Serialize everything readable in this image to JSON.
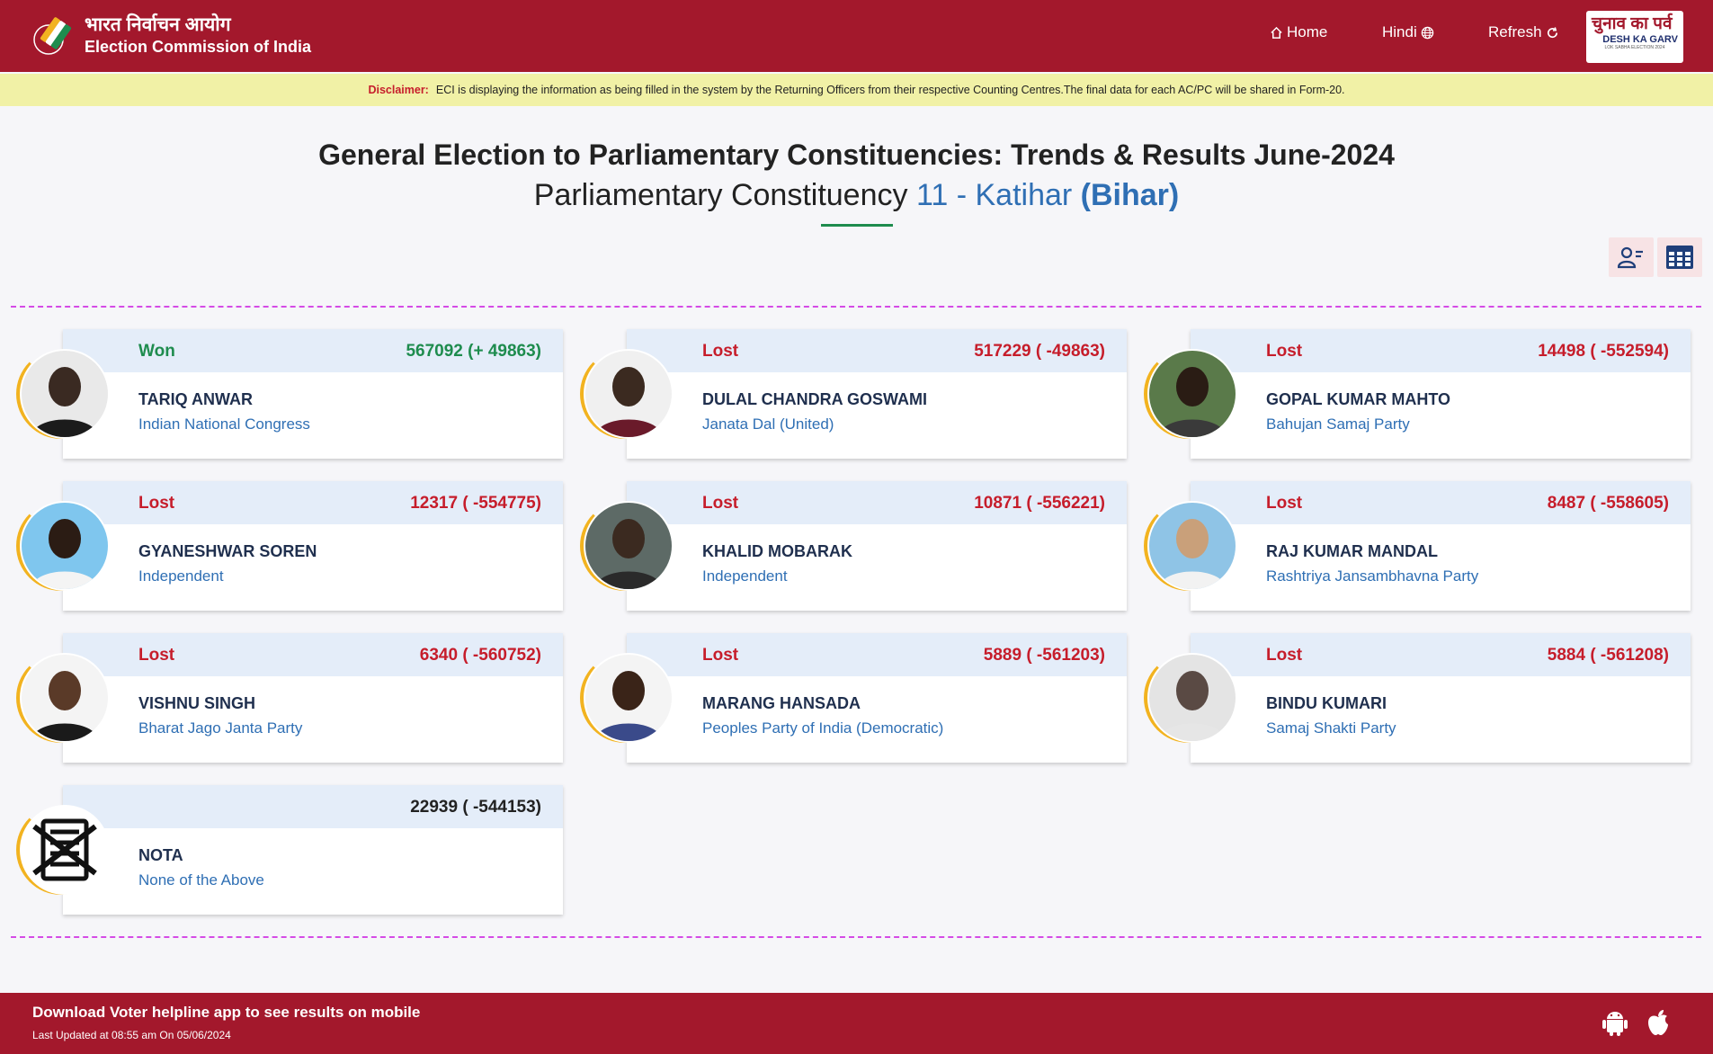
{
  "header": {
    "logo_hindi": "भारत निर्वाचन आयोग",
    "logo_english": "Election Commission of India",
    "nav": {
      "home": "Home",
      "language": "Hindi",
      "refresh": "Refresh"
    },
    "brand": {
      "hindi": "चुनाव का पर्व",
      "english": "DESH KA GARV",
      "small": "LOK SABHA ELECTION 2024"
    },
    "colors": {
      "primary": "#a3182c",
      "disclaimer_bg": "#f1f1a6"
    }
  },
  "disclaimer": {
    "label": "Disclaimer:",
    "text": "ECI is displaying the information as being filled in the system by the Returning Officers from their respective Counting Centres.The final data for each AC/PC will be shared in Form-20."
  },
  "page": {
    "title": "General Election to Parliamentary Constituencies: Trends & Results June-2024",
    "subtitle_prefix": "Parliamentary Constituency",
    "constituency": "11 - Katihar",
    "state": "(Bihar)"
  },
  "candidates": [
    {
      "status": "Won",
      "votes": "567092 (+ 49863)",
      "name": "TARIQ ANWAR",
      "party": "Indian National Congress"
    },
    {
      "status": "Lost",
      "votes": "517229 ( -49863)",
      "name": "DULAL CHANDRA GOSWAMI",
      "party": "Janata Dal (United)"
    },
    {
      "status": "Lost",
      "votes": "14498 ( -552594)",
      "name": "GOPAL KUMAR MAHTO",
      "party": "Bahujan Samaj Party"
    },
    {
      "status": "Lost",
      "votes": "12317 ( -554775)",
      "name": "GYANESHWAR SOREN",
      "party": "Independent"
    },
    {
      "status": "Lost",
      "votes": "10871 ( -556221)",
      "name": "KHALID MOBARAK",
      "party": "Independent"
    },
    {
      "status": "Lost",
      "votes": "8487 ( -558605)",
      "name": "RAJ KUMAR MANDAL",
      "party": "Rashtriya Jansambhavna Party"
    },
    {
      "status": "Lost",
      "votes": "6340 ( -560752)",
      "name": "VISHNU SINGH",
      "party": "Bharat Jago Janta Party"
    },
    {
      "status": "Lost",
      "votes": "5889 ( -561203)",
      "name": "MARANG HANSADA",
      "party": "Peoples Party of India (Democratic)"
    },
    {
      "status": "Lost",
      "votes": "5884 ( -561208)",
      "name": "BINDU KUMARI",
      "party": "Samaj Shakti Party"
    },
    {
      "status": "",
      "votes": "22939 ( -544153)",
      "name": "NOTA",
      "party": "None of the Above"
    }
  ],
  "footer": {
    "main": "Download Voter helpline app to see results on mobile",
    "updated": "Last Updated at 08:55 am On 05/06/2024",
    "icons": [
      "android-icon",
      "apple-icon"
    ]
  }
}
